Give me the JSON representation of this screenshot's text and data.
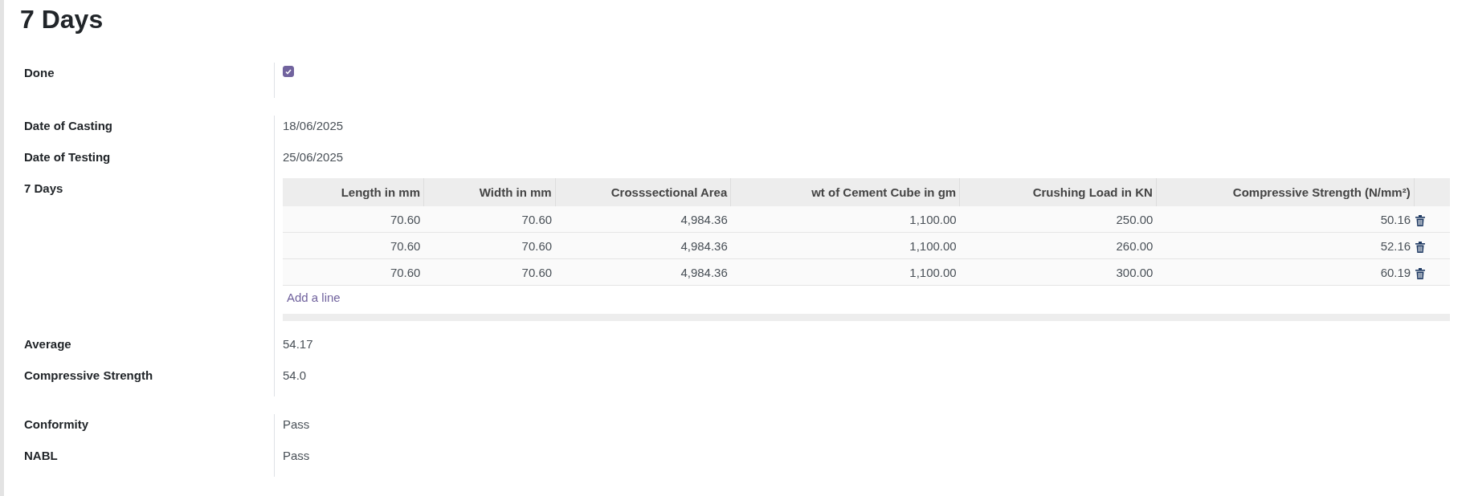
{
  "title": "7 Days",
  "groups": [
    {
      "fields": [
        {
          "kind": "checkbox",
          "label": "Done",
          "checked": true
        }
      ]
    },
    {
      "fields": [
        {
          "kind": "text",
          "label": "Date of Casting",
          "value": "18/06/2025"
        },
        {
          "kind": "text",
          "label": "Date of Testing",
          "value": "25/06/2025"
        },
        {
          "kind": "table",
          "label": "7 Days",
          "table": {
            "columns": [
              "Length in mm",
              "Width in mm",
              "Crosssectional Area",
              "wt of Cement Cube in gm",
              "Crushing Load in KN",
              "Compressive Strength (N/mm²)"
            ],
            "rows": [
              {
                "cells": [
                  "70.60",
                  "70.60",
                  "4,984.36",
                  "1,100.00",
                  "250.00",
                  "50.16"
                ]
              },
              {
                "cells": [
                  "70.60",
                  "70.60",
                  "4,984.36",
                  "1,100.00",
                  "260.00",
                  "52.16"
                ]
              },
              {
                "cells": [
                  "70.60",
                  "70.60",
                  "4,984.36",
                  "1,100.00",
                  "300.00",
                  "60.19"
                ]
              }
            ],
            "add_line": "Add a line"
          }
        },
        {
          "kind": "text",
          "label": "Average",
          "value": "54.17"
        },
        {
          "kind": "text",
          "label": "Compressive Strength",
          "value": "54.0"
        }
      ]
    },
    {
      "fields": [
        {
          "kind": "text",
          "label": "Conformity",
          "value": "Pass"
        },
        {
          "kind": "text",
          "label": "NABL",
          "value": "Pass"
        }
      ]
    }
  ]
}
